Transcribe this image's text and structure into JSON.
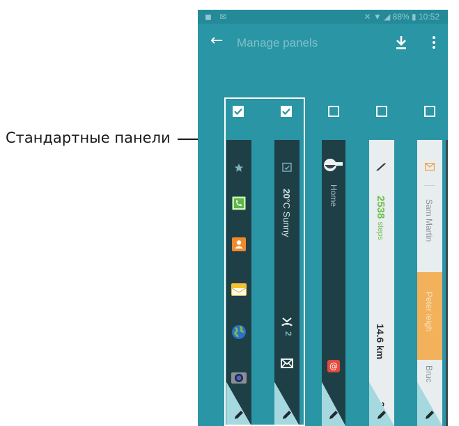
{
  "callout": {
    "label": "Стандартные панели"
  },
  "statusbar": {
    "left_icons": "◼ ✉",
    "right": "✕ ▼ ◢ 88% ▮ 10:52"
  },
  "appbar": {
    "back_icon": "arrow-left-icon",
    "title": "Manage panels",
    "download_icon": "download-icon",
    "more_icon": "more-vertical-icon"
  },
  "panels": [
    {
      "checked": true,
      "theme": "dark",
      "icons": [
        "star-icon",
        "phone-icon",
        "contacts-icon",
        "email-icon",
        "internet-icon",
        "camera-icon"
      ]
    },
    {
      "checked": true,
      "theme": "dark",
      "calendar_icon": "calendar-icon",
      "weather_bold": "20",
      "weather_rest": "°C Sunny",
      "missed_call_count": "2"
    },
    {
      "checked": false,
      "theme": "dark",
      "label": "Home"
    },
    {
      "checked": false,
      "theme": "light",
      "steps_value": "2538",
      "steps_unit": "steps",
      "distance": "14.6 km",
      "bottom_value": "20"
    },
    {
      "checked": false,
      "theme": "light",
      "contacts": [
        "Sam Martin",
        "Peter leigh",
        "Bruc"
      ],
      "accent": "#f2b15a"
    }
  ],
  "colors": {
    "background": "#2a95a4",
    "panel_dark": "#1f3f47",
    "panel_light": "#e8edf0",
    "steps_green": "#6fbf4a",
    "highlight": "#f2b15a"
  }
}
